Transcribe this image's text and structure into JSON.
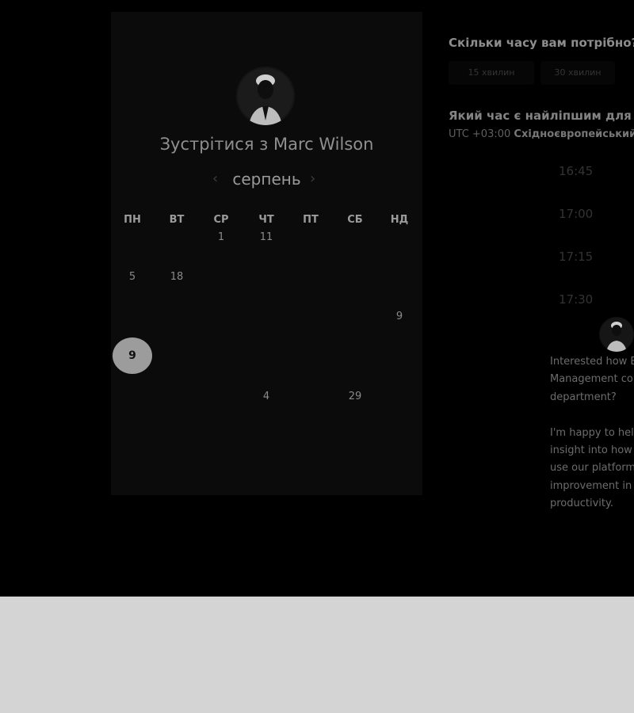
{
  "booking": {
    "title": "Зустрітися з Marc Wilson",
    "month": "серпень",
    "prev_icon": "‹",
    "next_icon": "›"
  },
  "calendar": {
    "weekdays": [
      "ПН",
      "ВТ",
      "СР",
      "ЧТ",
      "ПТ",
      "СБ",
      "НД"
    ],
    "visible_days": [
      "1",
      "11",
      "5",
      "18",
      "9",
      "4",
      "29"
    ],
    "selected_day": "9"
  },
  "duration": {
    "question": "Скільки часу вам потрібно?",
    "options": [
      "15 хвилин",
      "30 хвилин"
    ]
  },
  "time": {
    "question": "Який час є найліпшим для вас",
    "tz_offset": "UTC +03:00",
    "tz_name": "Східноєвропейський ч",
    "slots": [
      "16:45",
      "17:00",
      "17:15",
      "17:30"
    ]
  },
  "message": {
    "lines": [
      "Interested how E",
      "Management cou",
      "department?",
      "I'm happy to help",
      "insight into how c",
      "use our platform t",
      "improvement in I",
      "productivity."
    ]
  }
}
